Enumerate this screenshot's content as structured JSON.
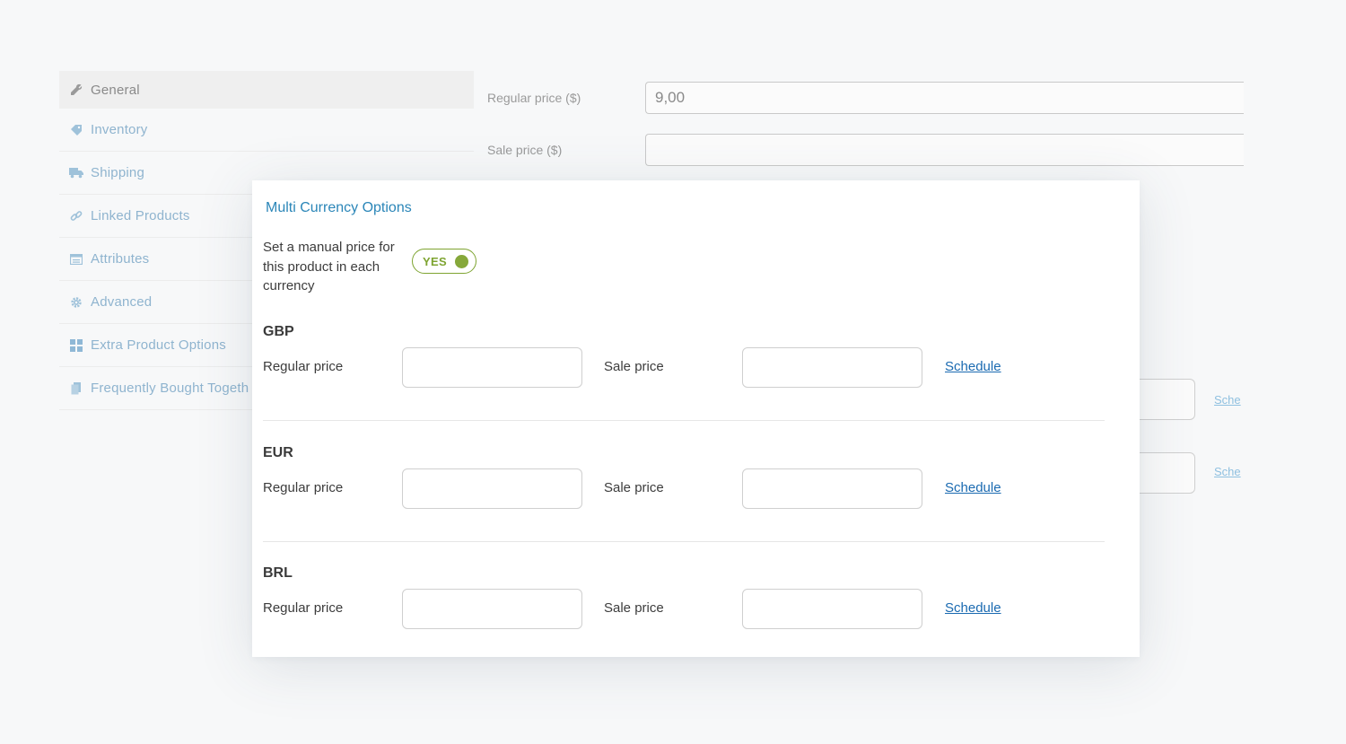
{
  "background": {
    "tabs": [
      {
        "label": "General",
        "icon": "wrench-icon",
        "active": true
      },
      {
        "label": "Inventory",
        "icon": "tag-icon",
        "active": false
      },
      {
        "label": "Shipping",
        "icon": "truck-icon",
        "active": false
      },
      {
        "label": "Linked Products",
        "icon": "link-icon",
        "active": false
      },
      {
        "label": "Attributes",
        "icon": "list-icon",
        "active": false
      },
      {
        "label": "Advanced",
        "icon": "gear-icon",
        "active": false
      },
      {
        "label": "Extra Product Options",
        "icon": "grid-icon",
        "active": false
      },
      {
        "label": "Frequently Bought Togeth",
        "icon": "copy-icon",
        "active": false
      }
    ],
    "regular_price_label": "Regular price ($)",
    "regular_price_value": "9,00",
    "sale_price_label": "Sale price ($)",
    "sale_price_value": "",
    "schedule_partial_1": "Sche",
    "schedule_partial_2": "Sche"
  },
  "modal": {
    "title": "Multi Currency Options",
    "manual_price_label": "Set a manual price for this product in each currency",
    "toggle_label": "YES",
    "accent_color": "#7ea431",
    "currencies": [
      {
        "code": "GBP",
        "regular_label": "Regular price",
        "regular_value": "",
        "sale_label": "Sale price",
        "sale_value": "",
        "schedule_label": "Schedule"
      },
      {
        "code": "EUR",
        "regular_label": "Regular price",
        "regular_value": "",
        "sale_label": "Sale price",
        "sale_value": "",
        "schedule_label": "Schedule"
      },
      {
        "code": "BRL",
        "regular_label": "Regular price",
        "regular_value": "",
        "sale_label": "Sale price",
        "sale_value": "",
        "schedule_label": "Schedule"
      }
    ]
  }
}
